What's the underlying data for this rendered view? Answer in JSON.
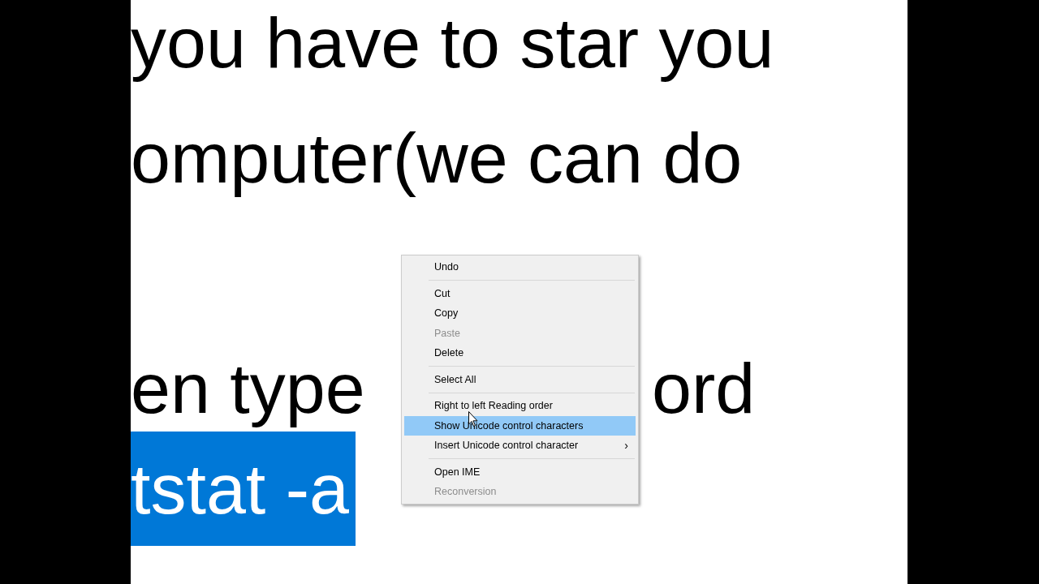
{
  "document": {
    "lines": [
      {
        "kind": "text",
        "segments": [
          "you have to star you"
        ]
      },
      {
        "kind": "text",
        "segments": [
          "omputer(we can do"
        ]
      },
      {
        "kind": "blank"
      },
      {
        "kind": "text",
        "segments": [
          "en type",
          "ord"
        ]
      },
      {
        "kind": "selected",
        "segments": [
          "tstat -a"
        ]
      }
    ]
  },
  "context_menu": {
    "items": [
      {
        "kind": "item",
        "label": "Undo",
        "disabled": false,
        "selected": false
      },
      {
        "kind": "separator"
      },
      {
        "kind": "item",
        "label": "Cut",
        "disabled": false,
        "selected": false
      },
      {
        "kind": "item",
        "label": "Copy",
        "disabled": false,
        "selected": false
      },
      {
        "kind": "item",
        "label": "Paste",
        "disabled": true,
        "selected": false
      },
      {
        "kind": "item",
        "label": "Delete",
        "disabled": false,
        "selected": false
      },
      {
        "kind": "separator"
      },
      {
        "kind": "item",
        "label": "Select All",
        "disabled": false,
        "selected": false
      },
      {
        "kind": "separator"
      },
      {
        "kind": "item",
        "label": "Right to left Reading order",
        "disabled": false,
        "selected": false
      },
      {
        "kind": "item",
        "label": "Show Unicode control characters",
        "disabled": false,
        "selected": true
      },
      {
        "kind": "item",
        "label": "Insert Unicode control character",
        "disabled": false,
        "selected": false,
        "submenu_arrow": "›"
      },
      {
        "kind": "separator"
      },
      {
        "kind": "item",
        "label": "Open IME",
        "disabled": false,
        "selected": false
      },
      {
        "kind": "item",
        "label": "Reconversion",
        "disabled": true,
        "selected": false
      }
    ]
  }
}
